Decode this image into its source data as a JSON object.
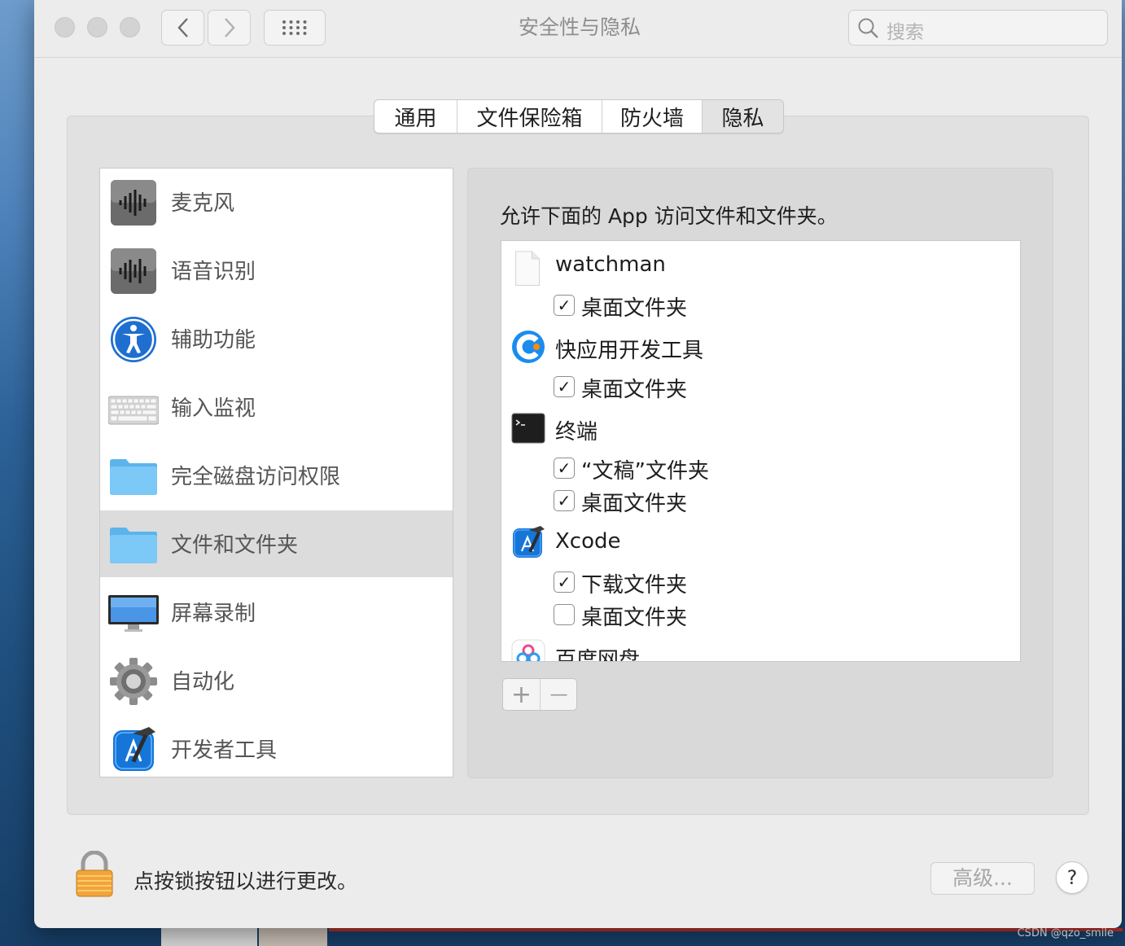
{
  "window": {
    "title": "安全性与隐私"
  },
  "toolbar": {
    "back_glyph": "<",
    "forward_glyph": ">",
    "show_all_icon": "grid-icon"
  },
  "search": {
    "placeholder": "搜索"
  },
  "tabs": [
    {
      "label": "通用",
      "active": false
    },
    {
      "label": "文件保险箱",
      "active": false
    },
    {
      "label": "防火墙",
      "active": false
    },
    {
      "label": "隐私",
      "active": true
    }
  ],
  "sidebar": {
    "items": [
      {
        "label": "麦克风",
        "icon": "microphone-icon"
      },
      {
        "label": "语音识别",
        "icon": "speech-recognition-icon"
      },
      {
        "label": "辅助功能",
        "icon": "accessibility-icon"
      },
      {
        "label": "输入监视",
        "icon": "keyboard-icon"
      },
      {
        "label": "完全磁盘访问权限",
        "icon": "folder-icon"
      },
      {
        "label": "文件和文件夹",
        "icon": "folder-icon",
        "selected": true
      },
      {
        "label": "屏幕录制",
        "icon": "display-icon"
      },
      {
        "label": "自动化",
        "icon": "gear-icon"
      },
      {
        "label": "开发者工具",
        "icon": "xcode-hammer-icon"
      }
    ]
  },
  "main": {
    "heading": "允许下面的 App 访问文件和文件夹。",
    "apps": [
      {
        "name": "watchman",
        "icon": "blank-document-icon",
        "permissions": [
          {
            "label": "桌面文件夹",
            "checked": true
          }
        ]
      },
      {
        "name": "快应用开发工具",
        "icon": "quickapp-icon",
        "permissions": [
          {
            "label": "桌面文件夹",
            "checked": true
          }
        ]
      },
      {
        "name": "终端",
        "icon": "terminal-icon",
        "permissions": [
          {
            "label": "“文稿”文件夹",
            "checked": true
          },
          {
            "label": "桌面文件夹",
            "checked": true
          }
        ]
      },
      {
        "name": "Xcode",
        "icon": "xcode-icon",
        "permissions": [
          {
            "label": "下载文件夹",
            "checked": true
          },
          {
            "label": "桌面文件夹",
            "checked": false
          }
        ]
      },
      {
        "name": "百度网盘",
        "icon": "baidu-netdisk-icon",
        "permissions": []
      }
    ],
    "add_glyph": "+",
    "remove_glyph": "—",
    "check_glyph": "✓"
  },
  "footer": {
    "lock_text": "点按锁按钮以进行更改。",
    "advanced_label": "高级...",
    "help_label": "?"
  },
  "watermark": "CSDN @qzo_smile"
}
